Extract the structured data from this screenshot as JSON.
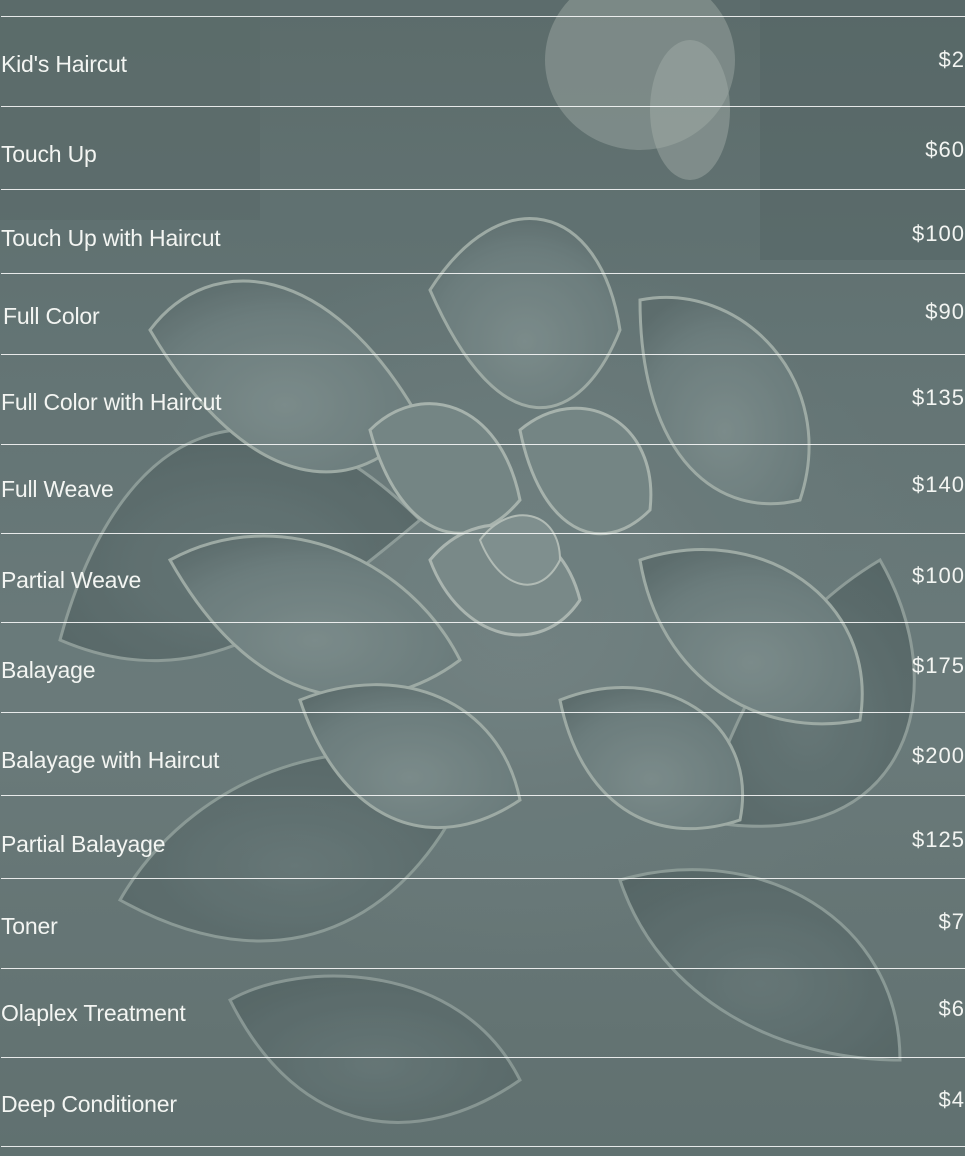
{
  "services": [
    {
      "name": "Kid's Haircut",
      "price": "$2"
    },
    {
      "name": "Touch Up",
      "price": "$60"
    },
    {
      "name": "Touch Up with Haircut",
      "price": "$100"
    },
    {
      "name": "Full Color",
      "price": "$90"
    },
    {
      "name": "Full Color with Haircut",
      "price": "$135"
    },
    {
      "name": "Full Weave",
      "price": "$140"
    },
    {
      "name": "Partial Weave",
      "price": "$100"
    },
    {
      "name": "Balayage",
      "price": "$175"
    },
    {
      "name": "Balayage with Haircut",
      "price": "$200"
    },
    {
      "name": "Partial Balayage",
      "price": "$125"
    },
    {
      "name": "Toner",
      "price": "$7"
    },
    {
      "name": "Olaplex Treatment",
      "price": "$6"
    },
    {
      "name": "Deep Conditioner",
      "price": "$4"
    }
  ],
  "colors": {
    "text": "#f3f5f2",
    "rule": "#ffffff",
    "background": "#6b7b7b"
  }
}
